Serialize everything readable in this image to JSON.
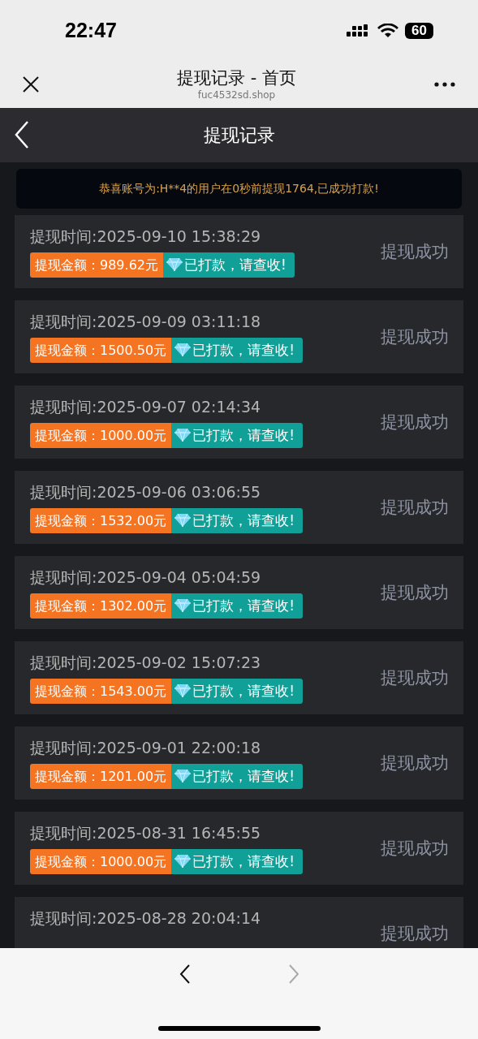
{
  "status_bar": {
    "time": "22:47",
    "battery": "60"
  },
  "browser": {
    "title": "提现记录 - 首页",
    "url": "fuc4532sd.shop"
  },
  "header": {
    "title": "提现记录"
  },
  "notice": "恭喜账号为:H**4的用户在0秒前提现1764,已成功打款!",
  "records": [
    {
      "time": "提现时间:2025-09-10 15:38:29",
      "amount": "提现金额：989.62元",
      "note": "已打款，请查收!",
      "status": "提现成功"
    },
    {
      "time": "提现时间:2025-09-09 03:11:18",
      "amount": "提现金额：1500.50元",
      "note": "已打款，请查收!",
      "status": "提现成功"
    },
    {
      "time": "提现时间:2025-09-07 02:14:34",
      "amount": "提现金额：1000.00元",
      "note": "已打款，请查收!",
      "status": "提现成功"
    },
    {
      "time": "提现时间:2025-09-06 03:06:55",
      "amount": "提现金额：1532.00元",
      "note": "已打款，请查收!",
      "status": "提现成功"
    },
    {
      "time": "提现时间:2025-09-04 05:04:59",
      "amount": "提现金额：1302.00元",
      "note": "已打款，请查收!",
      "status": "提现成功"
    },
    {
      "time": "提现时间:2025-09-02 15:07:23",
      "amount": "提现金额：1543.00元",
      "note": "已打款，请查收!",
      "status": "提现成功"
    },
    {
      "time": "提现时间:2025-09-01 22:00:18",
      "amount": "提现金额：1201.00元",
      "note": "已打款，请查收!",
      "status": "提现成功"
    },
    {
      "time": "提现时间:2025-08-31 16:45:55",
      "amount": "提现金额：1000.00元",
      "note": "已打款，请查收!",
      "status": "提现成功"
    },
    {
      "time": "提现时间:2025-08-28 20:04:14",
      "status": "提现成功"
    }
  ]
}
